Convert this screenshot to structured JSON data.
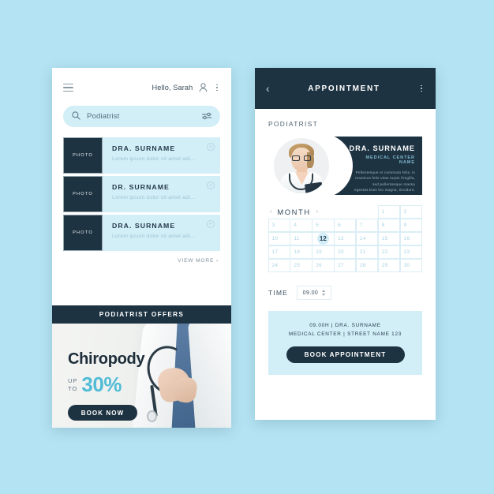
{
  "theme": {
    "page_background": "#b4e4f4",
    "navy": "#1e3342",
    "light_cyan": "#d2eef7",
    "accent_teal": "#52bcd6",
    "card_white": "#ffffff"
  },
  "home_screen": {
    "menu_icon": "hamburger-icon",
    "greeting": "Hello, Sarah",
    "user_icon": "user-icon",
    "more_icon": "kebab-menu-icon",
    "search": {
      "icon": "search-icon",
      "value": "Podiatrist",
      "placeholder": "Podiatrist",
      "filter_icon": "filter-sliders-icon"
    },
    "doctors": [
      {
        "photo_label": "PHOTO",
        "name": "DRA. SURNAME",
        "description": "Lorem ipsum dolor sit amet adi...",
        "add_icon": "plus-circle-icon"
      },
      {
        "photo_label": "PHOTO",
        "name": "DR. SURNAME",
        "description": "Lorem ipsum dolor sit amet adi...",
        "add_icon": "plus-circle-icon"
      },
      {
        "photo_label": "PHOTO",
        "name": "DRA. SURNAME",
        "description": "Lorem ipsum dolor sit amet adi...",
        "add_icon": "plus-circle-icon"
      }
    ],
    "view_more": "VIEW MORE  ›",
    "promo": {
      "banner_title": "PODIATRIST OFFERS",
      "headline": "Chiropody",
      "up": "UP",
      "to": "TO",
      "discount": "30%",
      "cta": "BOOK NOW"
    }
  },
  "appointment_screen": {
    "back_icon": "chevron-left-icon",
    "title": "APPOINTMENT",
    "more_icon": "kebab-menu-icon",
    "specialty": "PODIATRIST",
    "doctor_card": {
      "avatar": "doctor-portrait",
      "name": "DRA. SURNAME",
      "center": "MEDICAL CENTER NAME",
      "description": "Pellentesque et commodo felis, in maximus felis vitae turpis fringilla, sed pellentesque massa egestas.Duis leo magna, tincidunt."
    },
    "calendar": {
      "prev_icon": "chevron-left-icon",
      "month_label": "MONTH",
      "next_icon": "chevron-right-icon",
      "selected_day": "12",
      "rows": [
        [
          "",
          "",
          "",
          "",
          "",
          "1",
          "2"
        ],
        [
          "3",
          "4",
          "5",
          "6",
          "7",
          "8",
          "9"
        ],
        [
          "10",
          "11",
          "12",
          "13",
          "14",
          "15",
          "16"
        ],
        [
          "17",
          "18",
          "19",
          "20",
          "21",
          "22",
          "23"
        ],
        [
          "24",
          "25",
          "26",
          "27",
          "28",
          "29",
          "30"
        ]
      ]
    },
    "time": {
      "label": "TIME",
      "value": "09.00",
      "stepper_icon": "spinner-arrows-icon"
    },
    "confirm": {
      "line1": "09.00H  |  DRA. SURNAME",
      "line2": "MEDICAL CENTER  |  STREET NAME 123",
      "cta": "BOOK APPOINTMENT"
    }
  }
}
